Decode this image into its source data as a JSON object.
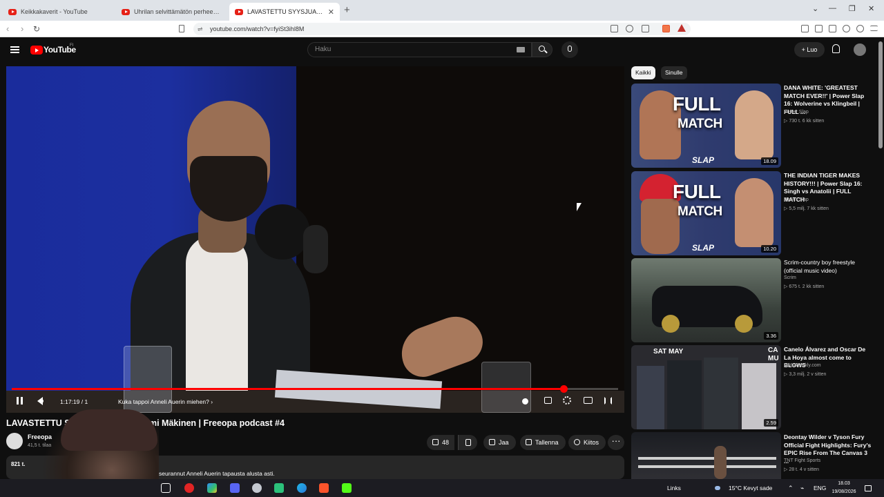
{
  "browser": {
    "tabs": [
      {
        "title": "Keikkakaverit - YouTube"
      },
      {
        "title": "Uhrilan selvittämätön perheensän m"
      },
      {
        "title": "LAVASTETTU SYYSJUAALRIIKO"
      }
    ],
    "new_tab": "+",
    "url": "youtube.com/watch?v=fyiSt3ihl8M"
  },
  "youtube": {
    "logo_text": "YouTube",
    "country_code": "FI",
    "search_placeholder": "Haku",
    "create_label": "+ Luo"
  },
  "player": {
    "time": "1:17:19 / 1",
    "chapter": "Kuka tappoi Anneli Auerin miehen? ›",
    "progress_fraction": 0.91
  },
  "video": {
    "title": "LAVASTETTU S          ANNELI AUER | Rami Mäkinen | Freeopa podcast #4",
    "channel": "Freeopa",
    "subscribers": "41,5 t. tilaa",
    "actions": {
      "like_count": "48",
      "share": "Jaa",
      "save": "Tallenna",
      "thanks": "Kiitos",
      "more": "···"
    },
    "description_views": "821 t.",
    "description_text": "seurannut Anneli Auerin tapausta alusta asti."
  },
  "sidebar": {
    "chips": [
      "Kaikki",
      "Sinulle"
    ],
    "recommendations": [
      {
        "title": "DANA WHITE: 'GREATEST MATCH EVER!!' | Power Slap 16: Wolverine vs Klingbeil | FULL ...",
        "channel": "Power Slap",
        "meta": "▷ 730 t.   6 kk sitten",
        "duration": "18.09"
      },
      {
        "title": "THE INDIAN TIGER MAKES HISTORY!!! | Power Slap 16: Singh vs Anatolii | FULL MATCH",
        "channel": "Power Slap",
        "meta": "▷ 5,5 milj.   7 kk sitten",
        "duration": "10.20"
      },
      {
        "title": "Scrim-country boy freestyle (official music video)",
        "channel": "Scrim",
        "meta": "▷ 675 t.   2 kk sitten",
        "duration": "3.36"
      },
      {
        "title": "Canelo Álvarez and Oscar De La Hoya almost come to BLOWS",
        "channel": "MMAWeekly.com",
        "meta": "▷ 3,3 milj.   2 v sitten",
        "duration": "2.59"
      },
      {
        "title": "Deontay Wilder v Tyson Fury Official Fight Highlights: Fury's EPIC Rise From The Canvas 3 ...",
        "channel": "TNT Fight Sports",
        "meta": "▷ 28 t.   4 v sitten",
        "duration": ""
      }
    ],
    "thumb_texts": {
      "full": "FULL",
      "match": "MATCH",
      "slap": "SLAP",
      "sat_may": "SAT MAY",
      "ca": "CA",
      "mu": "MU"
    }
  },
  "taskbar": {
    "links": "Links",
    "weather": "15°C  Kevyt sade",
    "lang": "ENG",
    "time": "18.03",
    "date": "19/08/2026"
  },
  "colors": {
    "accent": "#ff0000",
    "bg": "#0f0f0f",
    "pill": "#272727"
  }
}
